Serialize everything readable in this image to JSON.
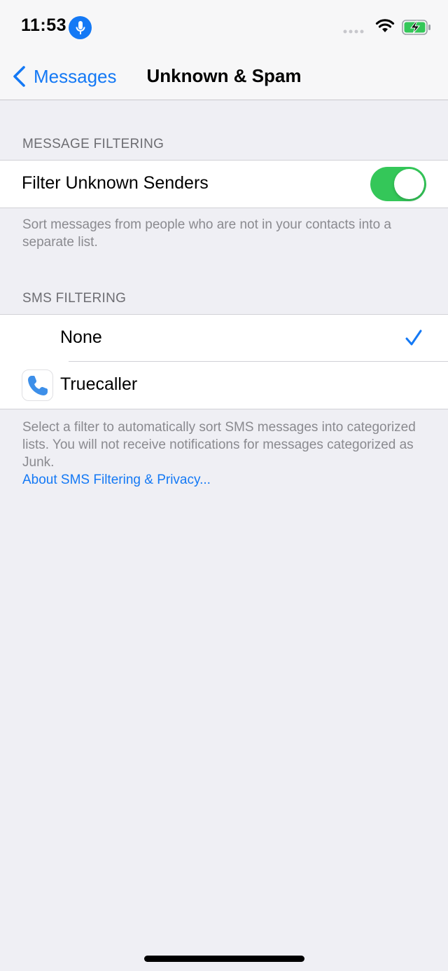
{
  "status_bar": {
    "time": "11:53",
    "mic_icon": "microphone-icon",
    "wifi_icon": "wifi-icon",
    "battery_icon": "battery-charging-icon",
    "signal_icon": "signal-dots-icon"
  },
  "nav": {
    "back_label": "Messages",
    "title": "Unknown & Spam"
  },
  "message_filtering": {
    "header": "MESSAGE FILTERING",
    "filter_unknown_label": "Filter Unknown Senders",
    "filter_unknown_on": true,
    "footer": "Sort messages from people who are not in your contacts into a separate list."
  },
  "sms_filtering": {
    "header": "SMS FILTERING",
    "options": [
      {
        "label": "None",
        "selected": true
      },
      {
        "label": "Truecaller",
        "selected": false,
        "icon": "phone-icon"
      }
    ],
    "footer": "Select a filter to automatically sort SMS messages into categorized lists. You will not receive notifications for messages categorized as Junk.",
    "link": "About SMS Filtering & Privacy..."
  },
  "colors": {
    "accent": "#1479f5",
    "toggle_on": "#34c759",
    "background": "#efeff4"
  }
}
